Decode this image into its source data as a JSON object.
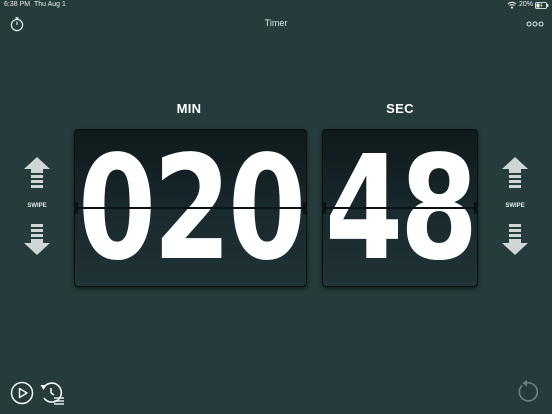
{
  "status_bar": {
    "time": "6:38 PM",
    "date": "Thu Aug 1",
    "battery": "20%"
  },
  "header": {
    "title": "Timer",
    "left_icon": "stopwatch-icon",
    "right_icon": "more-icon"
  },
  "timer": {
    "min_label": "MIN",
    "sec_label": "SEC",
    "minutes": "020",
    "seconds": "48"
  },
  "swipe": {
    "left_label": "SWIPE",
    "right_label": "SWIPE"
  },
  "footer": {
    "icons": [
      "play-icon",
      "history-icon",
      "reset-icon"
    ]
  },
  "colors": {
    "background": "#263b3b",
    "card": "#16262a",
    "text": "#ffffff",
    "accent_icon": "#c8d4d4"
  }
}
